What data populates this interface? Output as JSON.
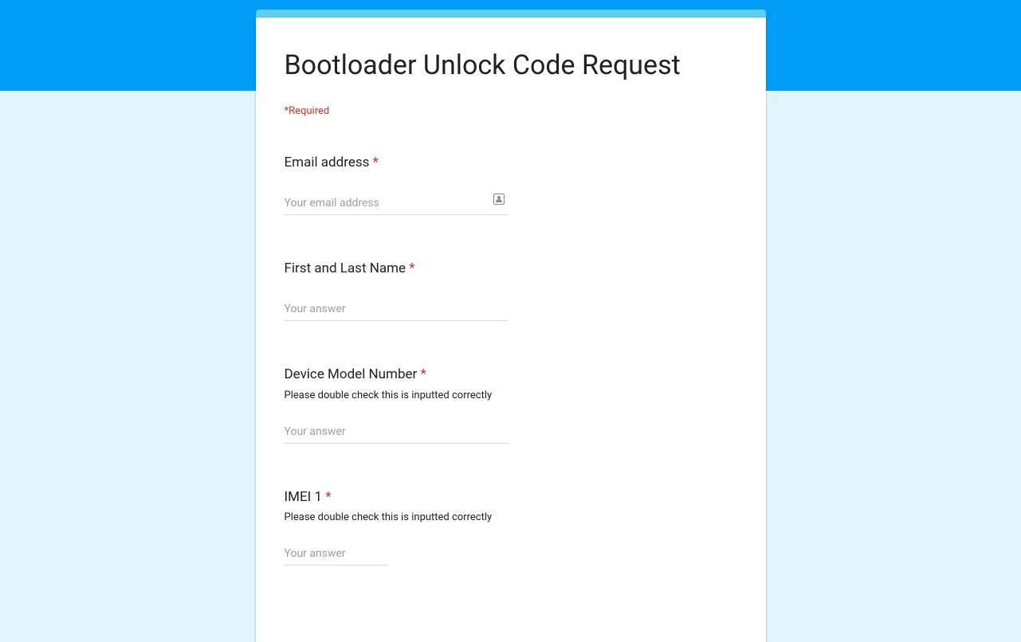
{
  "form": {
    "title": "Bootloader Unlock Code Request",
    "required_label": "*Required",
    "asterisk": "*",
    "questions": {
      "email": {
        "label": "Email address ",
        "placeholder": "Your email address"
      },
      "name": {
        "label": "First and Last Name ",
        "placeholder": "Your answer"
      },
      "device": {
        "label": "Device Model Number ",
        "help": "Please double check this is inputted correctly",
        "placeholder": "Your answer"
      },
      "imei1": {
        "label": "IMEI 1 ",
        "help": "Please double check this is inputted correctly",
        "placeholder": "Your answer"
      }
    }
  }
}
